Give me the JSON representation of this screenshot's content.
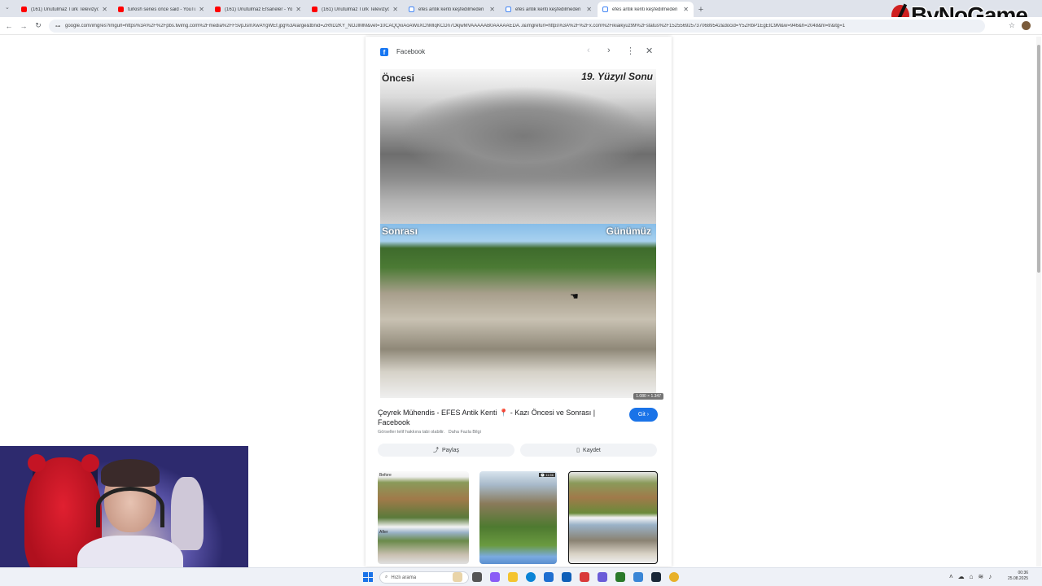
{
  "browser": {
    "tabs": [
      {
        "title": "(161) Unutulmaz Türk Televizyo...",
        "favicon": "youtube",
        "active": false
      },
      {
        "title": "turkish series once said - YouTu...",
        "favicon": "youtube",
        "active": false
      },
      {
        "title": "(161) Unutulmaz Efsaneler - You...",
        "favicon": "youtube",
        "active": false
      },
      {
        "title": "(161) Unutulmaz Türk Televizyo...",
        "favicon": "youtube",
        "active": false
      },
      {
        "title": "efes antik kenti keşfedilmeden",
        "favicon": "google",
        "active": false
      },
      {
        "title": "efes antik kenti keşfedilmeden",
        "favicon": "google",
        "active": false
      },
      {
        "title": "efes antik kenti keşfedilmeden",
        "favicon": "google",
        "active": true
      }
    ],
    "new_tab": "+",
    "tab_dropdown": "⌄",
    "url": "google.com/imgres?imgurl=https%3A%2F%2Fpbs.twimg.com%2Fmedia%2FFSvpJsmXwAYgWEf.jpg%3Alarge&tbnid=ZRhD2KY_NOJIMM&vet=10CAQQxiAoAWoXChMIqKCDn7OkjwMVAAAAAB0AAAAAEDA..i&imgrefurl=https%3A%2F%2Fx.com%2Fikiaikyuz99%2Fstatus%2F1525569257370689542&docid=Y5ZRbP1EgEtC9M&w=946&h=2048&hl=tr&itg=1",
    "nav": {
      "back": "←",
      "forward": "→",
      "reload": "↻",
      "site_info": "⊶"
    }
  },
  "logo": {
    "text": "ByNoGame"
  },
  "viewer": {
    "source": "Facebook",
    "controls": {
      "prev": "‹",
      "next": "›",
      "more": "⋮",
      "close": "✕"
    },
    "image": {
      "label_tl_top": "Öncesi",
      "label_tr_top": "19. Yüzyıl Sonu",
      "label_tl_bottom": "Sonrası",
      "label_tr_bottom": "Günümüz",
      "dimensions": "1.080 × 1.347"
    },
    "result_title": "Çeyrek Mühendis - EFES Antik Kenti 📍 - Kazı Öncesi ve Sonrası | Facebook",
    "result_subtitle": "Görseller telif hakkına tabi olabilir.",
    "result_more": "Daha Fazla Bilgi",
    "visit_label": "Git ›",
    "share_label": "Paylaş",
    "save_label": "Kaydet",
    "related": [
      {
        "tag": "Before",
        "tag2": "After",
        "badge": ""
      },
      {
        "tag": "",
        "tag2": "",
        "badge": "🕐 11:56"
      },
      {
        "tag": "",
        "tag2": "",
        "badge": ""
      }
    ]
  },
  "taskbar": {
    "search_placeholder": "Hızlı arama",
    "time": "00:36",
    "date": "25.08.2025"
  }
}
